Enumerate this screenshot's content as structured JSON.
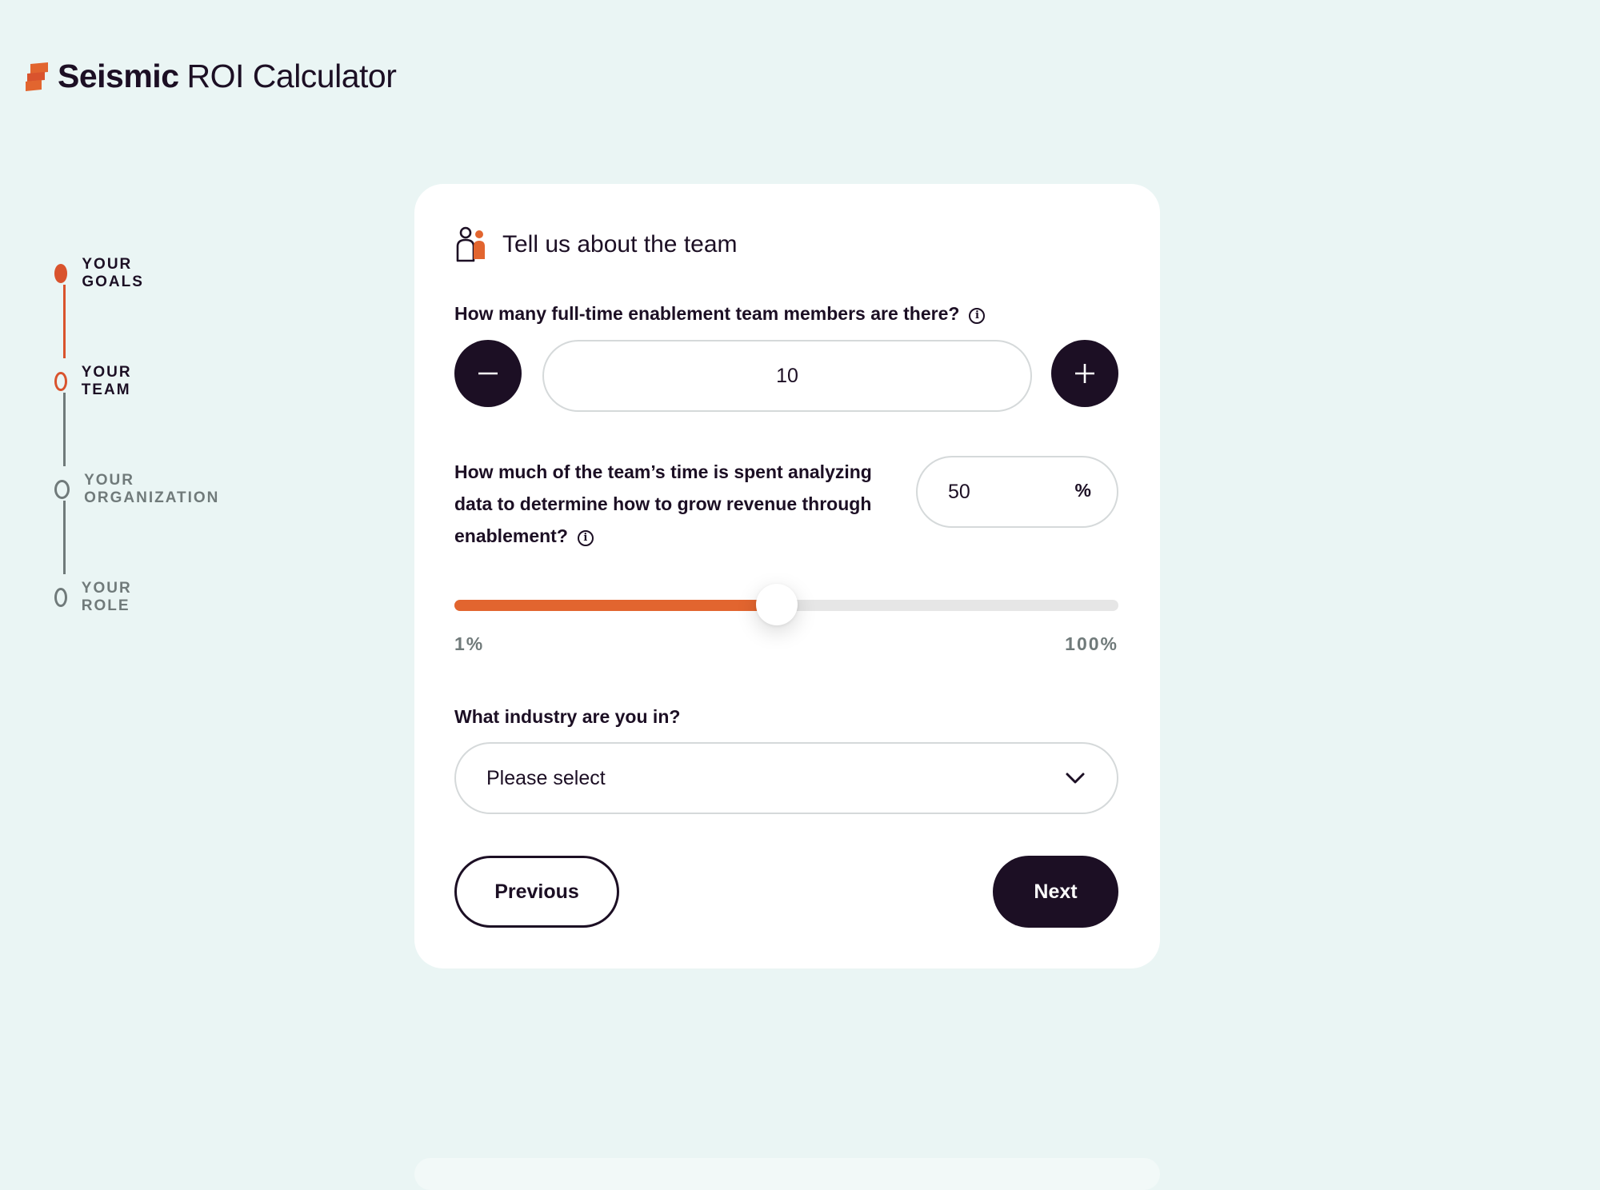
{
  "header": {
    "brand": "Seismic",
    "product": "ROI Calculator"
  },
  "stepper": {
    "steps": [
      {
        "label": "YOUR GOALS",
        "state": "done"
      },
      {
        "label": "YOUR TEAM",
        "state": "current"
      },
      {
        "label": "YOUR ORGANIZATION",
        "state": "upcoming"
      },
      {
        "label": "YOUR ROLE",
        "state": "upcoming"
      }
    ]
  },
  "card": {
    "title": "Tell us about the team",
    "icon": "team-icon",
    "q1": {
      "label": "How many full-time enablement team members are there?",
      "value": "10"
    },
    "q2": {
      "label": "How much of the team’s time is spent analyzing data to determine how to grow revenue through enablement?",
      "value": "50",
      "unit": "%",
      "slider_min_label": "1%",
      "slider_max_label": "100%",
      "slider_value_percent": 50
    },
    "q3": {
      "label": "What industry are you in?",
      "placeholder": "Please select"
    },
    "buttons": {
      "previous": "Previous",
      "next": "Next"
    }
  },
  "colors": {
    "accent": "#e2652f",
    "brand_dark": "#1c0f24",
    "background": "#eaf5f4",
    "muted": "#707a7a"
  }
}
